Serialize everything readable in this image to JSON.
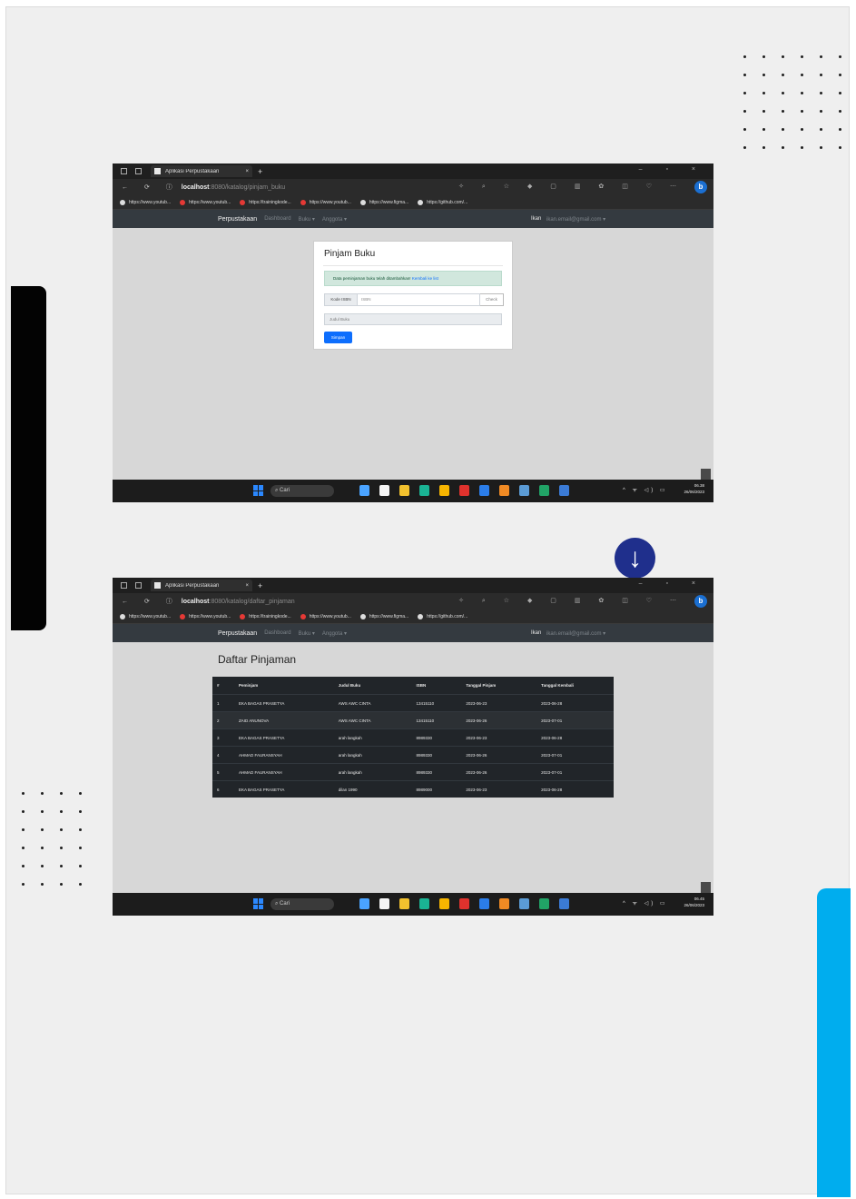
{
  "page": {
    "accent_colors": {
      "black_bar": "#030303",
      "blue_bar": "#00adee",
      "arrow_circle": "#1f2f8c"
    }
  },
  "browser": {
    "tab_title": "Aplikasi Perpustakaan",
    "tab_close": "×",
    "new_tab": "+",
    "window_controls": "– ▫ ×",
    "nav_icons": "← ⟳ ⓘ",
    "bookmarks": [
      "https://www.youtub...",
      "https://www.youtub...",
      "https://trainingkode...",
      "https://www.youtub...",
      "https://www.figma...",
      "https://github.com/..."
    ],
    "bing": "b"
  },
  "app": {
    "brand": "Perpustakaan",
    "nav_links": [
      "Dashboard",
      "Buku ▾",
      "Anggota ▾"
    ],
    "user": "Ikan",
    "email": "ikan.email@gmail.com ▾"
  },
  "screen1": {
    "url_host": "localhost",
    "url_path": ":8080/katalog/pinjam_buku",
    "card_title": "Pinjam Buku",
    "alert_text": "Data peminjaman buku telah ditambahkan!",
    "alert_link": "Kembali ke list",
    "kode_label": "Kode ISBN",
    "kode_placeholder": "ISBN",
    "check_button": "Check",
    "judul_placeholder": "Judul Buku",
    "submit_button": "Simpan"
  },
  "screen2": {
    "url_host": "localhost",
    "url_path": ":8080/katalog/daftar_pinjaman",
    "title": "Daftar Pinjaman",
    "table": {
      "headers": [
        "#",
        "Peminjam",
        "Judul Buku",
        "ISBN",
        "Tanggal Pinjam",
        "Tanggal Kembali"
      ],
      "rows": [
        [
          "1",
          "EKA BAGAS PRASETYA",
          "AWS AWC CINTA",
          "13415110",
          "2023-06-23",
          "2023-06-28"
        ],
        [
          "2",
          "ZAID ANUNOVA",
          "AWS AWC CINTA",
          "13415110",
          "2023-06-26",
          "2023-07-01"
        ],
        [
          "3",
          "EKA BAGAS PRASETYA",
          "arah langkah",
          "8989330",
          "2023-06-23",
          "2023-06-28"
        ],
        [
          "4",
          "AHMAD FAURANSYAH",
          "arah langkah",
          "8989330",
          "2023-06-26",
          "2023-07-01"
        ],
        [
          "5",
          "AHMAD FAURANSYAH",
          "arah langkah",
          "8989330",
          "2023-06-26",
          "2023-07-01"
        ],
        [
          "6",
          "EKA BAGAS PRASETYA",
          "dilan 1990",
          "8989000",
          "2023-06-23",
          "2023-06-28"
        ]
      ]
    }
  },
  "taskbar": {
    "search": "Cari",
    "tray": "^ ᯤ ◁) ▭",
    "clock1_time": "06.38",
    "clock1_date": "26/06/2023",
    "clock2_time": "06.45",
    "clock2_date": "26/06/2023",
    "app_colors": [
      "#4aa3ff",
      "#f5f5f5",
      "#f2c12e",
      "#1ab394",
      "#f7b500",
      "#e0322d",
      "#2b7de9",
      "#f08a24",
      "#5b9bd5",
      "#21a366",
      "#3b7bd6"
    ]
  },
  "arrow": "↓"
}
